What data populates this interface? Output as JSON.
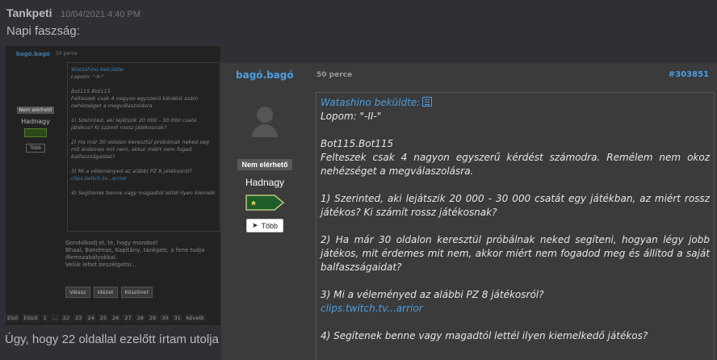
{
  "chat": {
    "author": "Tankpeti",
    "timestamp": "10/04/2021 4:40 PM",
    "message": "Napi faszság:",
    "bottom_message": "Úgy, hogy 22 oldallal ezelőtt írtam utolja"
  },
  "background_embed": {
    "user": "bagó.bagó",
    "age": "50 perce",
    "status": "Nem elérhető",
    "rank": "Hadnagy",
    "more": "Több",
    "lines": [
      "Watashino beküldte:",
      "Lopom: \"-II-\"",
      "",
      "Bot115.Bot115",
      "Felteszek csak 4 nagyon egyszerű kérdést szám",
      "nehézséget a megválaszolásra.",
      "",
      "1) Szerinted, aki lejátszik 20 000 - 30 000 csatá",
      "játékos? Ki számít rossz játékosnak?",
      "",
      "2) Ha már 30 oldalon keresztül próbálnak neked seg",
      "mit érdemes mit nem, akkor miért nem fogad",
      "balfaszságaidat?",
      "",
      "3) Mi a véleményed az alábbi PZ 8 játékosról?",
      "clips.twitch.tv...arrior",
      "",
      "4) Segítenek benne vagy magadtól lettél ilyen kiemelk"
    ],
    "footer_lines": [
      "Gondolkodj el, te, hogy mondod!",
      "Bhaal, Bandreas, Kapitány, tankpeti, a fene tudja",
      "illemszabályokkal.",
      "Velük lehet beszélgetni..."
    ],
    "buttons": [
      "Válasz",
      "Idézet",
      "Köszönet"
    ],
    "pager": [
      "Első",
      "Előző",
      "1",
      "...",
      "22",
      "23",
      "24",
      "25",
      "26",
      "27",
      "28",
      "29",
      "30",
      "31",
      "Követk"
    ]
  },
  "post": {
    "user": "bagó.bagó",
    "age": "50 perce",
    "post_id": "#303851",
    "status": "Nem elérhető",
    "rank": "Hadnagy",
    "more_label": "Több",
    "quote_author": "Watashino beküldte:",
    "lines": {
      "l1": "Lopom: \"-II-\"",
      "l2": "Bot115.Bot115",
      "l3": "Felteszek csak 4 nagyon egyszerű kérdést számodra. Remélem nem okoz nehézséget a megválaszolásra.",
      "l4": "1) Szerinted, aki lejátszik 20 000 - 30 000 csatát egy játékban, az miért rossz játékos? Ki számít rossz játékosnak?",
      "l5": "2) Ha már 30 oldalon keresztül próbálnak neked segíteni, hogyan légy jobb játékos, mit érdemes mit nem, akkor miért nem fogadod meg és állítod a saját balfaszságaidat?",
      "l6": "3) Mi a véleményed az alábbi PZ 8 játékosról?",
      "link": "clips.twitch.tv...arrior",
      "l7": "4) Segítenek benne vagy magadtól lettél ilyen kiemelkedő játékos?"
    }
  },
  "colors": {
    "link": "#4a9ee3",
    "post_bg": "#3b3b3b",
    "chat_bg": "#2f3035",
    "rank_flag": "#1f5d2a"
  }
}
